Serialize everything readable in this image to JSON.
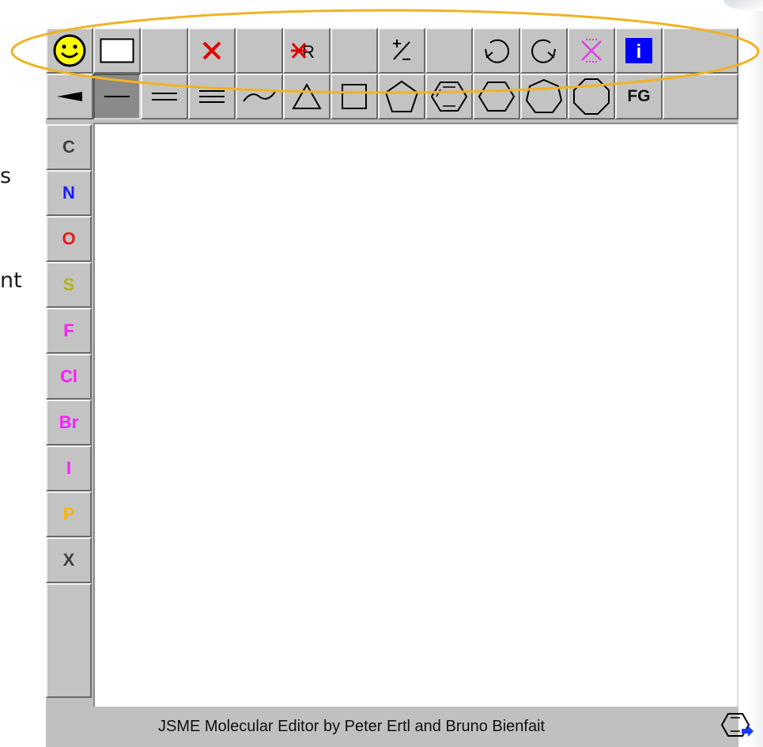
{
  "background_text": {
    "line1": "s",
    "line2": "nt"
  },
  "toolbar_top": [
    {
      "name": "smiley-icon",
      "label": ""
    },
    {
      "name": "new-molecule-button",
      "label": ""
    },
    {
      "name": "empty-button",
      "label": ""
    },
    {
      "name": "delete-button",
      "label": "×"
    },
    {
      "name": "empty-button",
      "label": ""
    },
    {
      "name": "delete-r-group-button",
      "label": "R"
    },
    {
      "name": "empty-button",
      "label": ""
    },
    {
      "name": "charge-button",
      "label": "±"
    },
    {
      "name": "empty-button",
      "label": ""
    },
    {
      "name": "undo-button",
      "label": ""
    },
    {
      "name": "redo-button",
      "label": ""
    },
    {
      "name": "clear-query-button",
      "label": ""
    },
    {
      "name": "info-button",
      "label": "i"
    }
  ],
  "toolbar_bottom": {
    "fg_label": "FG"
  },
  "atoms": [
    {
      "symbol": "C",
      "color": "#404040"
    },
    {
      "symbol": "N",
      "color": "#1a1aff"
    },
    {
      "symbol": "O",
      "color": "#e61a1a"
    },
    {
      "symbol": "S",
      "color": "#b3b31a"
    },
    {
      "symbol": "F",
      "color": "#ff1aff"
    },
    {
      "symbol": "Cl",
      "color": "#ff1aff"
    },
    {
      "symbol": "Br",
      "color": "#ff1aff"
    },
    {
      "symbol": "I",
      "color": "#ff1aff"
    },
    {
      "symbol": "P",
      "color": "#ffb300"
    },
    {
      "symbol": "X",
      "color": "#404040"
    }
  ],
  "status_bar": {
    "text": "JSME Molecular Editor by Peter Ertl and Bruno Bienfait"
  },
  "colors": {
    "highlight": "#f0b323",
    "smiley_yellow": "#ffff00",
    "delete_red": "#e00000",
    "info_blue": "#0000ff",
    "arrow_blue": "#1a3cff",
    "query_magenta": "#e040e0"
  }
}
